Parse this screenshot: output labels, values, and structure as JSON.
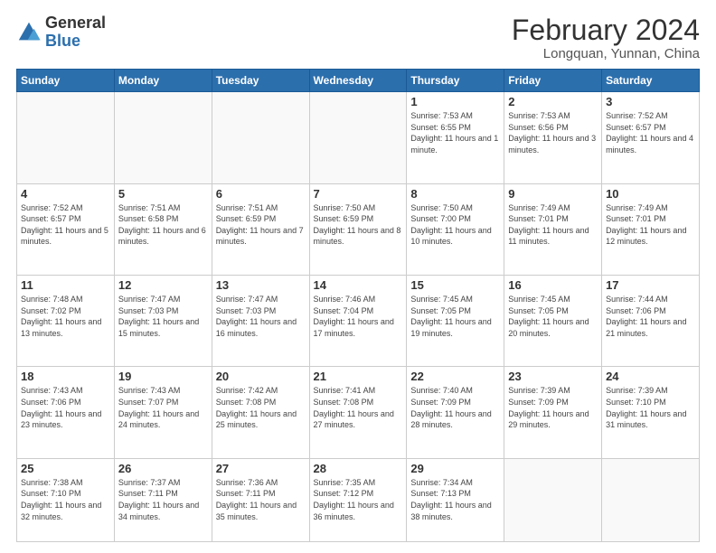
{
  "header": {
    "logo_general": "General",
    "logo_blue": "Blue",
    "title": "February 2024",
    "subtitle": "Longquan, Yunnan, China"
  },
  "days_of_week": [
    "Sunday",
    "Monday",
    "Tuesday",
    "Wednesday",
    "Thursday",
    "Friday",
    "Saturday"
  ],
  "weeks": [
    [
      {
        "day": "",
        "info": ""
      },
      {
        "day": "",
        "info": ""
      },
      {
        "day": "",
        "info": ""
      },
      {
        "day": "",
        "info": ""
      },
      {
        "day": "1",
        "info": "Sunrise: 7:53 AM\nSunset: 6:55 PM\nDaylight: 11 hours and 1 minute."
      },
      {
        "day": "2",
        "info": "Sunrise: 7:53 AM\nSunset: 6:56 PM\nDaylight: 11 hours and 3 minutes."
      },
      {
        "day": "3",
        "info": "Sunrise: 7:52 AM\nSunset: 6:57 PM\nDaylight: 11 hours and 4 minutes."
      }
    ],
    [
      {
        "day": "4",
        "info": "Sunrise: 7:52 AM\nSunset: 6:57 PM\nDaylight: 11 hours and 5 minutes."
      },
      {
        "day": "5",
        "info": "Sunrise: 7:51 AM\nSunset: 6:58 PM\nDaylight: 11 hours and 6 minutes."
      },
      {
        "day": "6",
        "info": "Sunrise: 7:51 AM\nSunset: 6:59 PM\nDaylight: 11 hours and 7 minutes."
      },
      {
        "day": "7",
        "info": "Sunrise: 7:50 AM\nSunset: 6:59 PM\nDaylight: 11 hours and 8 minutes."
      },
      {
        "day": "8",
        "info": "Sunrise: 7:50 AM\nSunset: 7:00 PM\nDaylight: 11 hours and 10 minutes."
      },
      {
        "day": "9",
        "info": "Sunrise: 7:49 AM\nSunset: 7:01 PM\nDaylight: 11 hours and 11 minutes."
      },
      {
        "day": "10",
        "info": "Sunrise: 7:49 AM\nSunset: 7:01 PM\nDaylight: 11 hours and 12 minutes."
      }
    ],
    [
      {
        "day": "11",
        "info": "Sunrise: 7:48 AM\nSunset: 7:02 PM\nDaylight: 11 hours and 13 minutes."
      },
      {
        "day": "12",
        "info": "Sunrise: 7:47 AM\nSunset: 7:03 PM\nDaylight: 11 hours and 15 minutes."
      },
      {
        "day": "13",
        "info": "Sunrise: 7:47 AM\nSunset: 7:03 PM\nDaylight: 11 hours and 16 minutes."
      },
      {
        "day": "14",
        "info": "Sunrise: 7:46 AM\nSunset: 7:04 PM\nDaylight: 11 hours and 17 minutes."
      },
      {
        "day": "15",
        "info": "Sunrise: 7:45 AM\nSunset: 7:05 PM\nDaylight: 11 hours and 19 minutes."
      },
      {
        "day": "16",
        "info": "Sunrise: 7:45 AM\nSunset: 7:05 PM\nDaylight: 11 hours and 20 minutes."
      },
      {
        "day": "17",
        "info": "Sunrise: 7:44 AM\nSunset: 7:06 PM\nDaylight: 11 hours and 21 minutes."
      }
    ],
    [
      {
        "day": "18",
        "info": "Sunrise: 7:43 AM\nSunset: 7:06 PM\nDaylight: 11 hours and 23 minutes."
      },
      {
        "day": "19",
        "info": "Sunrise: 7:43 AM\nSunset: 7:07 PM\nDaylight: 11 hours and 24 minutes."
      },
      {
        "day": "20",
        "info": "Sunrise: 7:42 AM\nSunset: 7:08 PM\nDaylight: 11 hours and 25 minutes."
      },
      {
        "day": "21",
        "info": "Sunrise: 7:41 AM\nSunset: 7:08 PM\nDaylight: 11 hours and 27 minutes."
      },
      {
        "day": "22",
        "info": "Sunrise: 7:40 AM\nSunset: 7:09 PM\nDaylight: 11 hours and 28 minutes."
      },
      {
        "day": "23",
        "info": "Sunrise: 7:39 AM\nSunset: 7:09 PM\nDaylight: 11 hours and 29 minutes."
      },
      {
        "day": "24",
        "info": "Sunrise: 7:39 AM\nSunset: 7:10 PM\nDaylight: 11 hours and 31 minutes."
      }
    ],
    [
      {
        "day": "25",
        "info": "Sunrise: 7:38 AM\nSunset: 7:10 PM\nDaylight: 11 hours and 32 minutes."
      },
      {
        "day": "26",
        "info": "Sunrise: 7:37 AM\nSunset: 7:11 PM\nDaylight: 11 hours and 34 minutes."
      },
      {
        "day": "27",
        "info": "Sunrise: 7:36 AM\nSunset: 7:11 PM\nDaylight: 11 hours and 35 minutes."
      },
      {
        "day": "28",
        "info": "Sunrise: 7:35 AM\nSunset: 7:12 PM\nDaylight: 11 hours and 36 minutes."
      },
      {
        "day": "29",
        "info": "Sunrise: 7:34 AM\nSunset: 7:13 PM\nDaylight: 11 hours and 38 minutes."
      },
      {
        "day": "",
        "info": ""
      },
      {
        "day": "",
        "info": ""
      }
    ]
  ]
}
